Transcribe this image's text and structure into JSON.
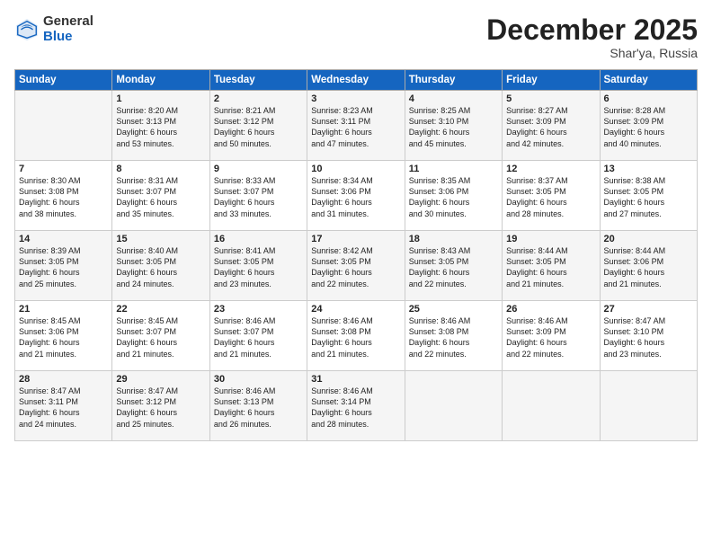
{
  "logo": {
    "general": "General",
    "blue": "Blue"
  },
  "title": "December 2025",
  "subtitle": "Shar'ya, Russia",
  "days_of_week": [
    "Sunday",
    "Monday",
    "Tuesday",
    "Wednesday",
    "Thursday",
    "Friday",
    "Saturday"
  ],
  "weeks": [
    [
      {
        "day": "",
        "info": ""
      },
      {
        "day": "1",
        "info": "Sunrise: 8:20 AM\nSunset: 3:13 PM\nDaylight: 6 hours\nand 53 minutes."
      },
      {
        "day": "2",
        "info": "Sunrise: 8:21 AM\nSunset: 3:12 PM\nDaylight: 6 hours\nand 50 minutes."
      },
      {
        "day": "3",
        "info": "Sunrise: 8:23 AM\nSunset: 3:11 PM\nDaylight: 6 hours\nand 47 minutes."
      },
      {
        "day": "4",
        "info": "Sunrise: 8:25 AM\nSunset: 3:10 PM\nDaylight: 6 hours\nand 45 minutes."
      },
      {
        "day": "5",
        "info": "Sunrise: 8:27 AM\nSunset: 3:09 PM\nDaylight: 6 hours\nand 42 minutes."
      },
      {
        "day": "6",
        "info": "Sunrise: 8:28 AM\nSunset: 3:09 PM\nDaylight: 6 hours\nand 40 minutes."
      }
    ],
    [
      {
        "day": "7",
        "info": "Sunrise: 8:30 AM\nSunset: 3:08 PM\nDaylight: 6 hours\nand 38 minutes."
      },
      {
        "day": "8",
        "info": "Sunrise: 8:31 AM\nSunset: 3:07 PM\nDaylight: 6 hours\nand 35 minutes."
      },
      {
        "day": "9",
        "info": "Sunrise: 8:33 AM\nSunset: 3:07 PM\nDaylight: 6 hours\nand 33 minutes."
      },
      {
        "day": "10",
        "info": "Sunrise: 8:34 AM\nSunset: 3:06 PM\nDaylight: 6 hours\nand 31 minutes."
      },
      {
        "day": "11",
        "info": "Sunrise: 8:35 AM\nSunset: 3:06 PM\nDaylight: 6 hours\nand 30 minutes."
      },
      {
        "day": "12",
        "info": "Sunrise: 8:37 AM\nSunset: 3:05 PM\nDaylight: 6 hours\nand 28 minutes."
      },
      {
        "day": "13",
        "info": "Sunrise: 8:38 AM\nSunset: 3:05 PM\nDaylight: 6 hours\nand 27 minutes."
      }
    ],
    [
      {
        "day": "14",
        "info": "Sunrise: 8:39 AM\nSunset: 3:05 PM\nDaylight: 6 hours\nand 25 minutes."
      },
      {
        "day": "15",
        "info": "Sunrise: 8:40 AM\nSunset: 3:05 PM\nDaylight: 6 hours\nand 24 minutes."
      },
      {
        "day": "16",
        "info": "Sunrise: 8:41 AM\nSunset: 3:05 PM\nDaylight: 6 hours\nand 23 minutes."
      },
      {
        "day": "17",
        "info": "Sunrise: 8:42 AM\nSunset: 3:05 PM\nDaylight: 6 hours\nand 22 minutes."
      },
      {
        "day": "18",
        "info": "Sunrise: 8:43 AM\nSunset: 3:05 PM\nDaylight: 6 hours\nand 22 minutes."
      },
      {
        "day": "19",
        "info": "Sunrise: 8:44 AM\nSunset: 3:05 PM\nDaylight: 6 hours\nand 21 minutes."
      },
      {
        "day": "20",
        "info": "Sunrise: 8:44 AM\nSunset: 3:06 PM\nDaylight: 6 hours\nand 21 minutes."
      }
    ],
    [
      {
        "day": "21",
        "info": "Sunrise: 8:45 AM\nSunset: 3:06 PM\nDaylight: 6 hours\nand 21 minutes."
      },
      {
        "day": "22",
        "info": "Sunrise: 8:45 AM\nSunset: 3:07 PM\nDaylight: 6 hours\nand 21 minutes."
      },
      {
        "day": "23",
        "info": "Sunrise: 8:46 AM\nSunset: 3:07 PM\nDaylight: 6 hours\nand 21 minutes."
      },
      {
        "day": "24",
        "info": "Sunrise: 8:46 AM\nSunset: 3:08 PM\nDaylight: 6 hours\nand 21 minutes."
      },
      {
        "day": "25",
        "info": "Sunrise: 8:46 AM\nSunset: 3:08 PM\nDaylight: 6 hours\nand 22 minutes."
      },
      {
        "day": "26",
        "info": "Sunrise: 8:46 AM\nSunset: 3:09 PM\nDaylight: 6 hours\nand 22 minutes."
      },
      {
        "day": "27",
        "info": "Sunrise: 8:47 AM\nSunset: 3:10 PM\nDaylight: 6 hours\nand 23 minutes."
      }
    ],
    [
      {
        "day": "28",
        "info": "Sunrise: 8:47 AM\nSunset: 3:11 PM\nDaylight: 6 hours\nand 24 minutes."
      },
      {
        "day": "29",
        "info": "Sunrise: 8:47 AM\nSunset: 3:12 PM\nDaylight: 6 hours\nand 25 minutes."
      },
      {
        "day": "30",
        "info": "Sunrise: 8:46 AM\nSunset: 3:13 PM\nDaylight: 6 hours\nand 26 minutes."
      },
      {
        "day": "31",
        "info": "Sunrise: 8:46 AM\nSunset: 3:14 PM\nDaylight: 6 hours\nand 28 minutes."
      },
      {
        "day": "",
        "info": ""
      },
      {
        "day": "",
        "info": ""
      },
      {
        "day": "",
        "info": ""
      }
    ]
  ]
}
